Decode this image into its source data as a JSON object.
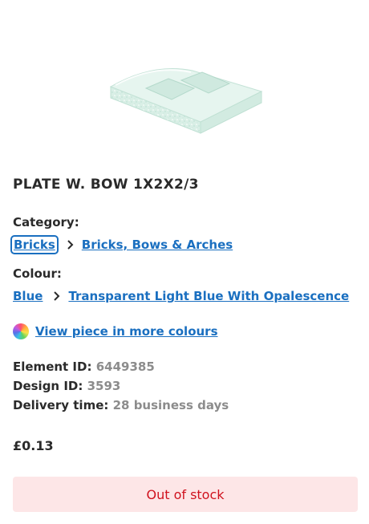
{
  "product": {
    "title": "PLATE W. BOW 1X2X2/3",
    "image_alt": "Transparent light blue plate with bow piece"
  },
  "category": {
    "label": "Category:",
    "crumbs": [
      "Bricks",
      "Bricks, Bows & Arches"
    ]
  },
  "colour": {
    "label": "Colour:",
    "crumbs": [
      "Blue",
      "Transparent Light Blue With Opalescence"
    ]
  },
  "more_colours": {
    "link_text": "View piece in more colours"
  },
  "details": {
    "element_id_label": "Element ID:",
    "element_id": "6449385",
    "design_id_label": "Design ID:",
    "design_id": "3593",
    "delivery_label": "Delivery time:",
    "delivery": "28 business days"
  },
  "price": "£0.13",
  "stock_button": {
    "label": "Out of stock"
  },
  "colors": {
    "link": "#1a6fc0",
    "out_of_stock_bg": "#fde6e7",
    "out_of_stock_text": "#d0121e",
    "value_grey": "#8c8c8c"
  },
  "icons": {
    "chevron": "chevron-right-icon",
    "colour_wheel": "colour-wheel-icon"
  }
}
